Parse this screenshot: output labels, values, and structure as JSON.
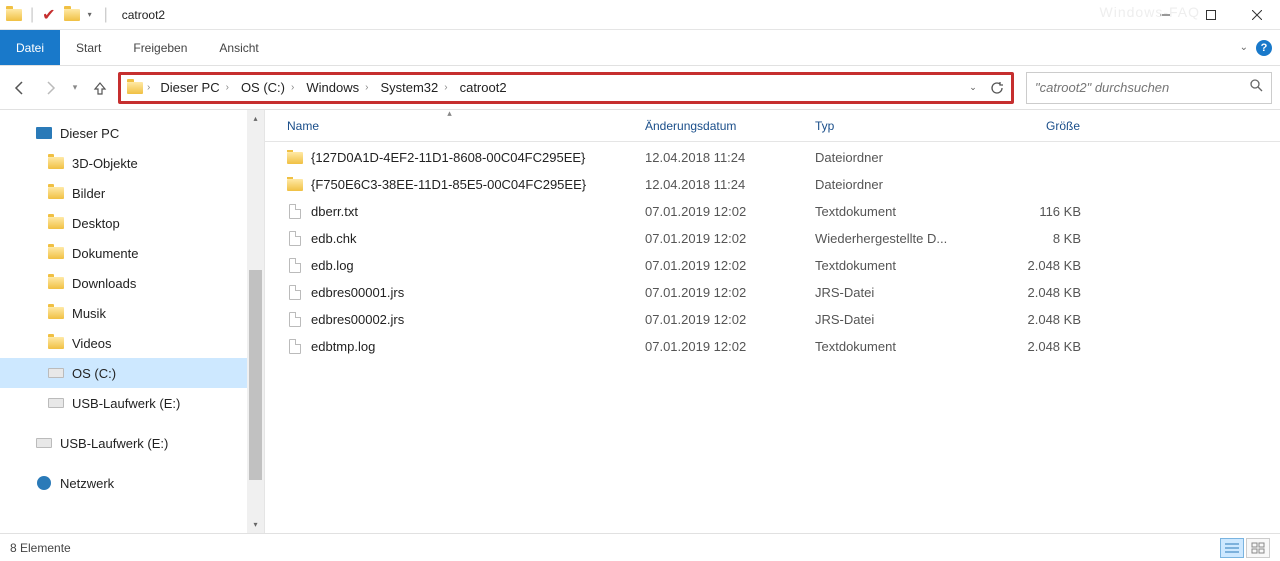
{
  "window": {
    "title": "catroot2"
  },
  "ribbon": {
    "tabs": [
      {
        "label": "Datei",
        "active": true
      },
      {
        "label": "Start",
        "active": false
      },
      {
        "label": "Freigeben",
        "active": false
      },
      {
        "label": "Ansicht",
        "active": false
      }
    ]
  },
  "breadcrumb": {
    "segments": [
      "Dieser PC",
      "OS (C:)",
      "Windows",
      "System32",
      "catroot2"
    ]
  },
  "search": {
    "placeholder": "\"catroot2\" durchsuchen"
  },
  "nav": {
    "items": [
      {
        "label": "Dieser PC",
        "icon": "pc",
        "level": 0,
        "selected": false
      },
      {
        "label": "3D-Objekte",
        "icon": "folder",
        "level": 1,
        "selected": false
      },
      {
        "label": "Bilder",
        "icon": "folder",
        "level": 1,
        "selected": false
      },
      {
        "label": "Desktop",
        "icon": "folder",
        "level": 1,
        "selected": false
      },
      {
        "label": "Dokumente",
        "icon": "folder",
        "level": 1,
        "selected": false
      },
      {
        "label": "Downloads",
        "icon": "folder",
        "level": 1,
        "selected": false
      },
      {
        "label": "Musik",
        "icon": "folder",
        "level": 1,
        "selected": false
      },
      {
        "label": "Videos",
        "icon": "folder",
        "level": 1,
        "selected": false
      },
      {
        "label": "OS (C:)",
        "icon": "drive",
        "level": 1,
        "selected": true
      },
      {
        "label": "USB-Laufwerk (E:)",
        "icon": "drive",
        "level": 1,
        "selected": false
      },
      {
        "label": "USB-Laufwerk (E:)",
        "icon": "drive",
        "level": 0,
        "selected": false
      },
      {
        "label": "Netzwerk",
        "icon": "net",
        "level": 0,
        "selected": false
      }
    ]
  },
  "columns": {
    "name": "Name",
    "date": "Änderungsdatum",
    "type": "Typ",
    "size": "Größe"
  },
  "files": [
    {
      "name": "{127D0A1D-4EF2-11D1-8608-00C04FC295EE}",
      "date": "12.04.2018 11:24",
      "type": "Dateiordner",
      "size": "",
      "icon": "folder"
    },
    {
      "name": "{F750E6C3-38EE-11D1-85E5-00C04FC295EE}",
      "date": "12.04.2018 11:24",
      "type": "Dateiordner",
      "size": "",
      "icon": "folder"
    },
    {
      "name": "dberr.txt",
      "date": "07.01.2019 12:02",
      "type": "Textdokument",
      "size": "116 KB",
      "icon": "doc"
    },
    {
      "name": "edb.chk",
      "date": "07.01.2019 12:02",
      "type": "Wiederhergestellte D...",
      "size": "8 KB",
      "icon": "doc"
    },
    {
      "name": "edb.log",
      "date": "07.01.2019 12:02",
      "type": "Textdokument",
      "size": "2.048 KB",
      "icon": "doc"
    },
    {
      "name": "edbres00001.jrs",
      "date": "07.01.2019 12:02",
      "type": "JRS-Datei",
      "size": "2.048 KB",
      "icon": "doc"
    },
    {
      "name": "edbres00002.jrs",
      "date": "07.01.2019 12:02",
      "type": "JRS-Datei",
      "size": "2.048 KB",
      "icon": "doc"
    },
    {
      "name": "edbtmp.log",
      "date": "07.01.2019 12:02",
      "type": "Textdokument",
      "size": "2.048 KB",
      "icon": "doc"
    }
  ],
  "status": {
    "count": "8 Elemente"
  }
}
